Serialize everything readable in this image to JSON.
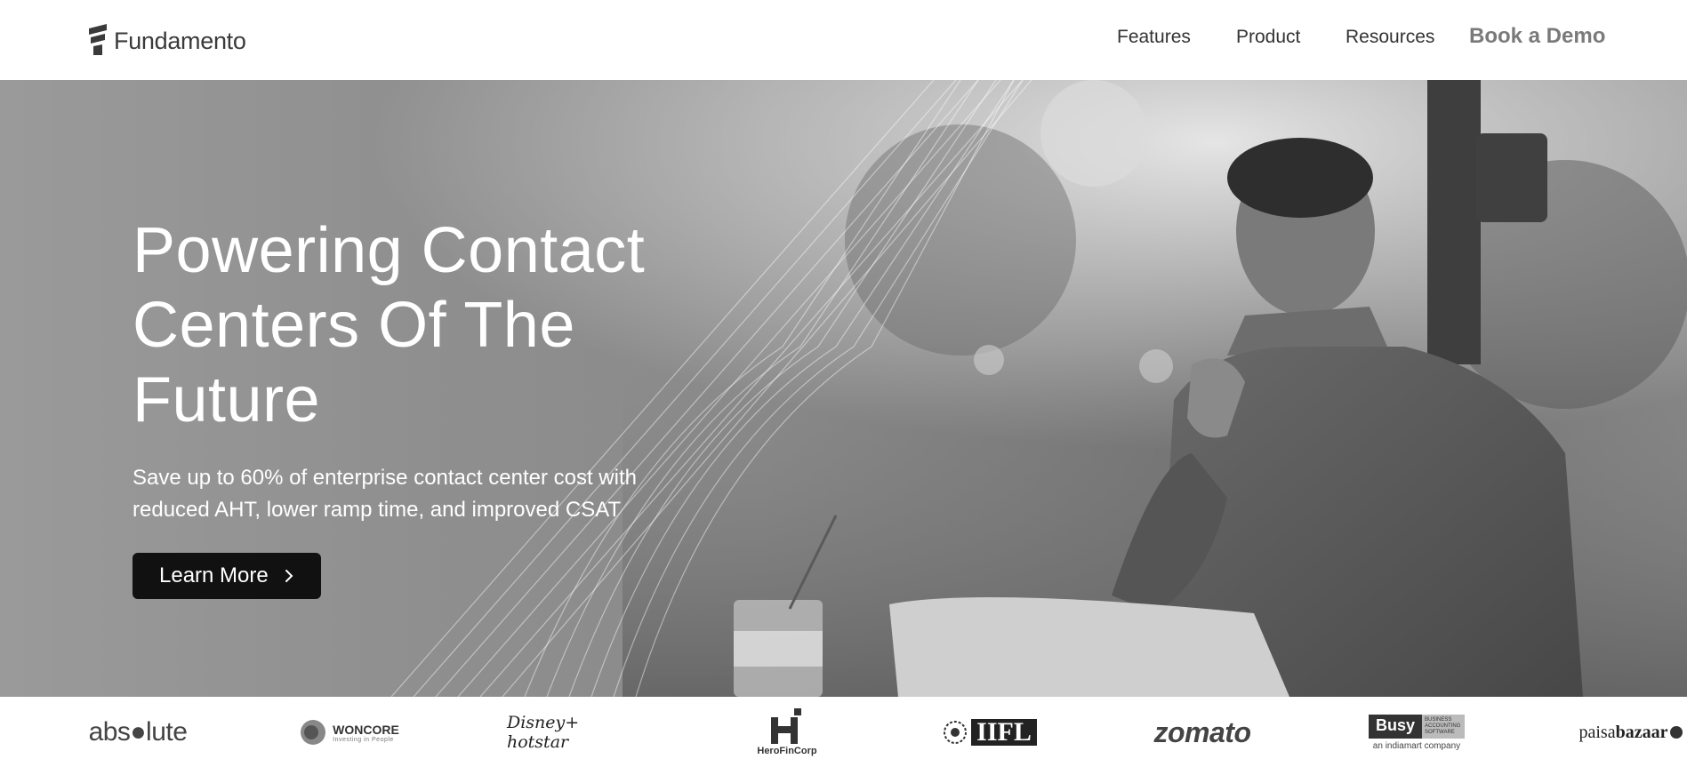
{
  "header": {
    "brand": "Fundamento",
    "nav": [
      {
        "label": "Features"
      },
      {
        "label": "Product"
      },
      {
        "label": "Resources"
      }
    ],
    "cta_label": "Book a Demo"
  },
  "hero": {
    "title_lines": [
      "Powering Contact",
      "Centers Of The",
      "Future"
    ],
    "subtitle_lines": [
      "Save up to 60% of enterprise contact center cost with",
      "reduced AHT, lower ramp time, and improved CSAT"
    ],
    "cta_label": "Learn More"
  },
  "clients": {
    "absolute": "abs●lute",
    "woncore": "WONCORE",
    "woncore_tagline": "Investing in People",
    "hotstar": "Disney+ hotstar",
    "herofincorp": "HeroFinCorp",
    "iifl": "IIFL",
    "zomato": "zomato",
    "busy": "Busy",
    "busy_sub": "BUSINESS ACCOUNTING SOFTWARE",
    "busy_company": "an indiamart company",
    "paisabazaar_1": "paisa",
    "paisabazaar_2": "bazaar"
  },
  "icons": [
    "logo-icon",
    "chevron-right-icon"
  ],
  "colors": {
    "cta_bg": "#111111",
    "header_bg": "#ffffff",
    "demo_link": "#7a7a7a"
  }
}
